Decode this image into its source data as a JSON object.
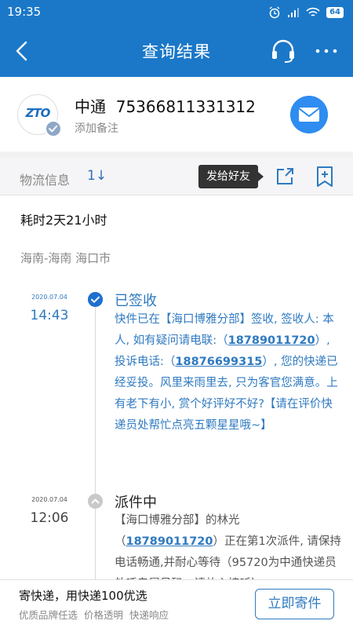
{
  "status_bar": {
    "time": "19:35",
    "battery": "64"
  },
  "nav": {
    "title": "查询结果"
  },
  "courier": {
    "name": "中通",
    "tracking_number": "75366811331312",
    "remark_placeholder": "添加备注",
    "logo_text": "ZTO"
  },
  "tabs": {
    "label": "物流信息",
    "sort_symbol": "1↓",
    "tooltip": "发给好友"
  },
  "summary": {
    "duration": "耗时2天21小时",
    "route": "海南-海南 海口市"
  },
  "events": [
    {
      "date": "2020.07.04",
      "time": "14:43",
      "status": "已签收",
      "detail_parts": [
        "快件已在【海口博雅分部】签收, 签收人: 本人, 如有疑问请电联:（",
        "18789011720",
        "）, 投诉电话:（",
        "18876699315",
        "）, 您的快递已经妥投。风里来雨里去, 只为客官您满意。上有老下有小, 赏个好评好不好?【请在评价快递员处帮忙点亮五颗星星哦~】"
      ]
    },
    {
      "date": "2020.07.04",
      "time": "12:06",
      "status": "派件中",
      "detail_parts": [
        "【海口博雅分部】的林光（",
        "18789011720",
        "）正在第1次派件, 请保持电话畅通,并耐心等待（95720为中通快递员外呼专属号码，请放心接听）"
      ]
    }
  ],
  "bottom": {
    "promo_title": "寄快递，用快递100优选",
    "promo_sub": "优质品牌任选 价格透明 快递响应",
    "send_button": "立即寄件"
  },
  "colors": {
    "primary": "#1b78c8",
    "accent": "#2f7ac0",
    "text_muted": "#888888"
  }
}
